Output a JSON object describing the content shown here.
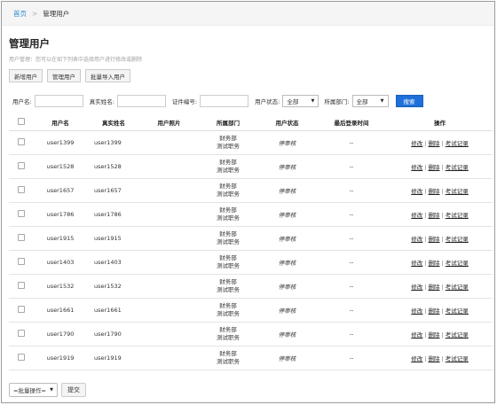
{
  "breadcrumb": {
    "home": "首页",
    "separator": ">",
    "current": "管理用户"
  },
  "page": {
    "title": "管理用户",
    "description": "用户管理：您可以在如下列表中选择用户进行修改或删除"
  },
  "actions": {
    "add": "新增用户",
    "manage": "管理用户",
    "import": "批量导入用户"
  },
  "filters": {
    "username_label": "用户名:",
    "realname_label": "真实姓名:",
    "idcard_label": "证件编号:",
    "status_label": "用户状态:",
    "status_value": "全部",
    "dept_label": "所属部门:",
    "dept_value": "全部",
    "search": "搜索"
  },
  "table": {
    "headers": [
      "用户名",
      "真实姓名",
      "用户照片",
      "所属部门",
      "用户状态",
      "最后登录时间",
      "操作"
    ],
    "rows": [
      {
        "username": "user1399",
        "realname": "user1399",
        "dept1": "财务部",
        "dept2": "测试职务",
        "status": "停审核",
        "last": "--"
      },
      {
        "username": "user1528",
        "realname": "user1528",
        "dept1": "财务部",
        "dept2": "测试职务",
        "status": "停审核",
        "last": "--"
      },
      {
        "username": "user1657",
        "realname": "user1657",
        "dept1": "财务部",
        "dept2": "测试职务",
        "status": "停审核",
        "last": "--"
      },
      {
        "username": "user1786",
        "realname": "user1786",
        "dept1": "财务部",
        "dept2": "测试职务",
        "status": "停审核",
        "last": "--"
      },
      {
        "username": "user1915",
        "realname": "user1915",
        "dept1": "财务部",
        "dept2": "测试职务",
        "status": "停审核",
        "last": "--"
      },
      {
        "username": "user1403",
        "realname": "user1403",
        "dept1": "财务部",
        "dept2": "测试职务",
        "status": "停审核",
        "last": "--"
      },
      {
        "username": "user1532",
        "realname": "user1532",
        "dept1": "财务部",
        "dept2": "测试职务",
        "status": "停审核",
        "last": "--"
      },
      {
        "username": "user1661",
        "realname": "user1661",
        "dept1": "财务部",
        "dept2": "测试职务",
        "status": "停审核",
        "last": "--"
      },
      {
        "username": "user1790",
        "realname": "user1790",
        "dept1": "财务部",
        "dept2": "测试职务",
        "status": "停审核",
        "last": "--"
      },
      {
        "username": "user1919",
        "realname": "user1919",
        "dept1": "财务部",
        "dept2": "测试职务",
        "status": "停审核",
        "last": "--"
      }
    ],
    "ops": {
      "edit": "修改",
      "delete": "删除",
      "exam": "考试记录",
      "sep": "|"
    }
  },
  "bottom": {
    "batch": "=批量操作=",
    "submit": "提交"
  }
}
